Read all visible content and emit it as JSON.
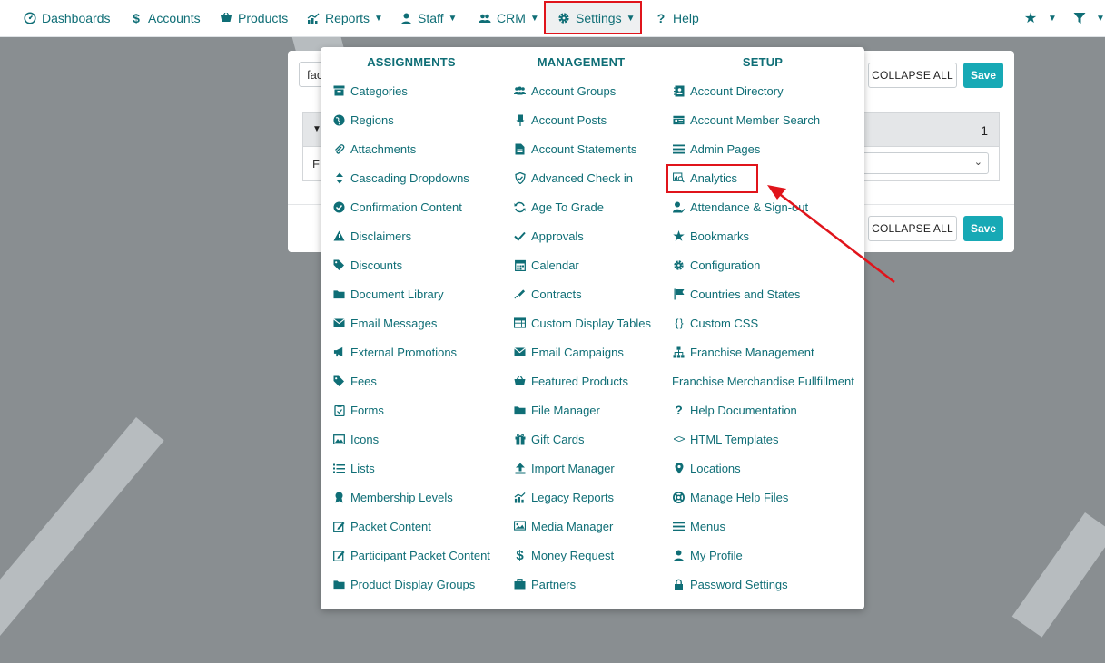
{
  "nav": {
    "dashboards": "Dashboards",
    "accounts": "Accounts",
    "products": "Products",
    "reports": "Reports",
    "staff": "Staff",
    "crm": "CRM",
    "settings": "Settings",
    "help": "Help"
  },
  "card": {
    "search_value": "fac",
    "collapse_label": "COLLAPSE ALL",
    "save_label": "Save",
    "panel_count": "1",
    "panel_field_label": "F"
  },
  "menu": {
    "assignments_title": "ASSIGNMENTS",
    "management_title": "MANAGEMENT",
    "setup_title": "SETUP",
    "assignments": [
      {
        "label": "Categories",
        "icon": "archive-icon"
      },
      {
        "label": "Regions",
        "icon": "globe-icon"
      },
      {
        "label": "Attachments",
        "icon": "paperclip-icon"
      },
      {
        "label": "Cascading Dropdowns",
        "icon": "sort-icon"
      },
      {
        "label": "Confirmation Content",
        "icon": "check-circle-icon"
      },
      {
        "label": "Disclaimers",
        "icon": "warning-icon"
      },
      {
        "label": "Discounts",
        "icon": "tags-icon"
      },
      {
        "label": "Document Library",
        "icon": "folder-icon"
      },
      {
        "label": "Email Messages",
        "icon": "envelope-icon"
      },
      {
        "label": "External Promotions",
        "icon": "bullhorn-icon"
      },
      {
        "label": "Fees",
        "icon": "tags-icon"
      },
      {
        "label": "Forms",
        "icon": "clipboard-icon"
      },
      {
        "label": "Icons",
        "icon": "image-icon"
      },
      {
        "label": "Lists",
        "icon": "list-icon"
      },
      {
        "label": "Membership Levels",
        "icon": "award-icon"
      },
      {
        "label": "Packet Content",
        "icon": "edit-icon"
      },
      {
        "label": "Participant Packet Content",
        "icon": "edit-icon"
      },
      {
        "label": "Product Display Groups",
        "icon": "folder-icon"
      }
    ],
    "management": [
      {
        "label": "Account Groups",
        "icon": "users-icon"
      },
      {
        "label": "Account Posts",
        "icon": "thumbtack-icon"
      },
      {
        "label": "Account Statements",
        "icon": "file-icon"
      },
      {
        "label": "Advanced Check in",
        "icon": "shield-check-icon"
      },
      {
        "label": "Age To Grade",
        "icon": "sync-icon"
      },
      {
        "label": "Approvals",
        "icon": "check-icon"
      },
      {
        "label": "Calendar",
        "icon": "calendar-icon"
      },
      {
        "label": "Contracts",
        "icon": "signature-icon"
      },
      {
        "label": "Custom Display Tables",
        "icon": "table-icon"
      },
      {
        "label": "Email Campaigns",
        "icon": "envelope-icon"
      },
      {
        "label": "Featured Products",
        "icon": "basket-icon"
      },
      {
        "label": "File Manager",
        "icon": "folder-icon"
      },
      {
        "label": "Gift Cards",
        "icon": "gift-icon"
      },
      {
        "label": "Import Manager",
        "icon": "upload-icon"
      },
      {
        "label": "Legacy Reports",
        "icon": "chart-icon"
      },
      {
        "label": "Media Manager",
        "icon": "photo-video-icon"
      },
      {
        "label": "Money Request",
        "icon": "dollar-icon"
      },
      {
        "label": "Partners",
        "icon": "briefcase-icon"
      }
    ],
    "setup": [
      {
        "label": "Account Directory",
        "icon": "address-book-icon"
      },
      {
        "label": "Account Member Search",
        "icon": "id-card-icon"
      },
      {
        "label": "Admin Pages",
        "icon": "bars-icon"
      },
      {
        "label": "Analytics",
        "icon": "analytics-search-icon"
      },
      {
        "label": "Attendance & Sign-out",
        "icon": "user-check-icon"
      },
      {
        "label": "Bookmarks",
        "icon": "star-icon"
      },
      {
        "label": "Configuration",
        "icon": "gear-icon"
      },
      {
        "label": "Countries and States",
        "icon": "flag-icon"
      },
      {
        "label": "Custom CSS",
        "icon": "braces-icon"
      },
      {
        "label": "Franchise Management",
        "icon": "sitemap-icon"
      },
      {
        "label": "Franchise Merchandise Fullfillment",
        "icon": ""
      },
      {
        "label": "Help Documentation",
        "icon": "question-icon"
      },
      {
        "label": "HTML Templates",
        "icon": "code-icon"
      },
      {
        "label": "Locations",
        "icon": "map-marker-icon"
      },
      {
        "label": "Manage Help Files",
        "icon": "life-ring-icon"
      },
      {
        "label": "Menus",
        "icon": "bars-icon"
      },
      {
        "label": "My Profile",
        "icon": "user-icon"
      },
      {
        "label": "Password Settings",
        "icon": "lock-icon"
      }
    ]
  },
  "colors": {
    "accent": "#0f6e76",
    "save_button": "#17a9b5",
    "highlight": "#e0141b",
    "backdrop": "#898e91"
  }
}
